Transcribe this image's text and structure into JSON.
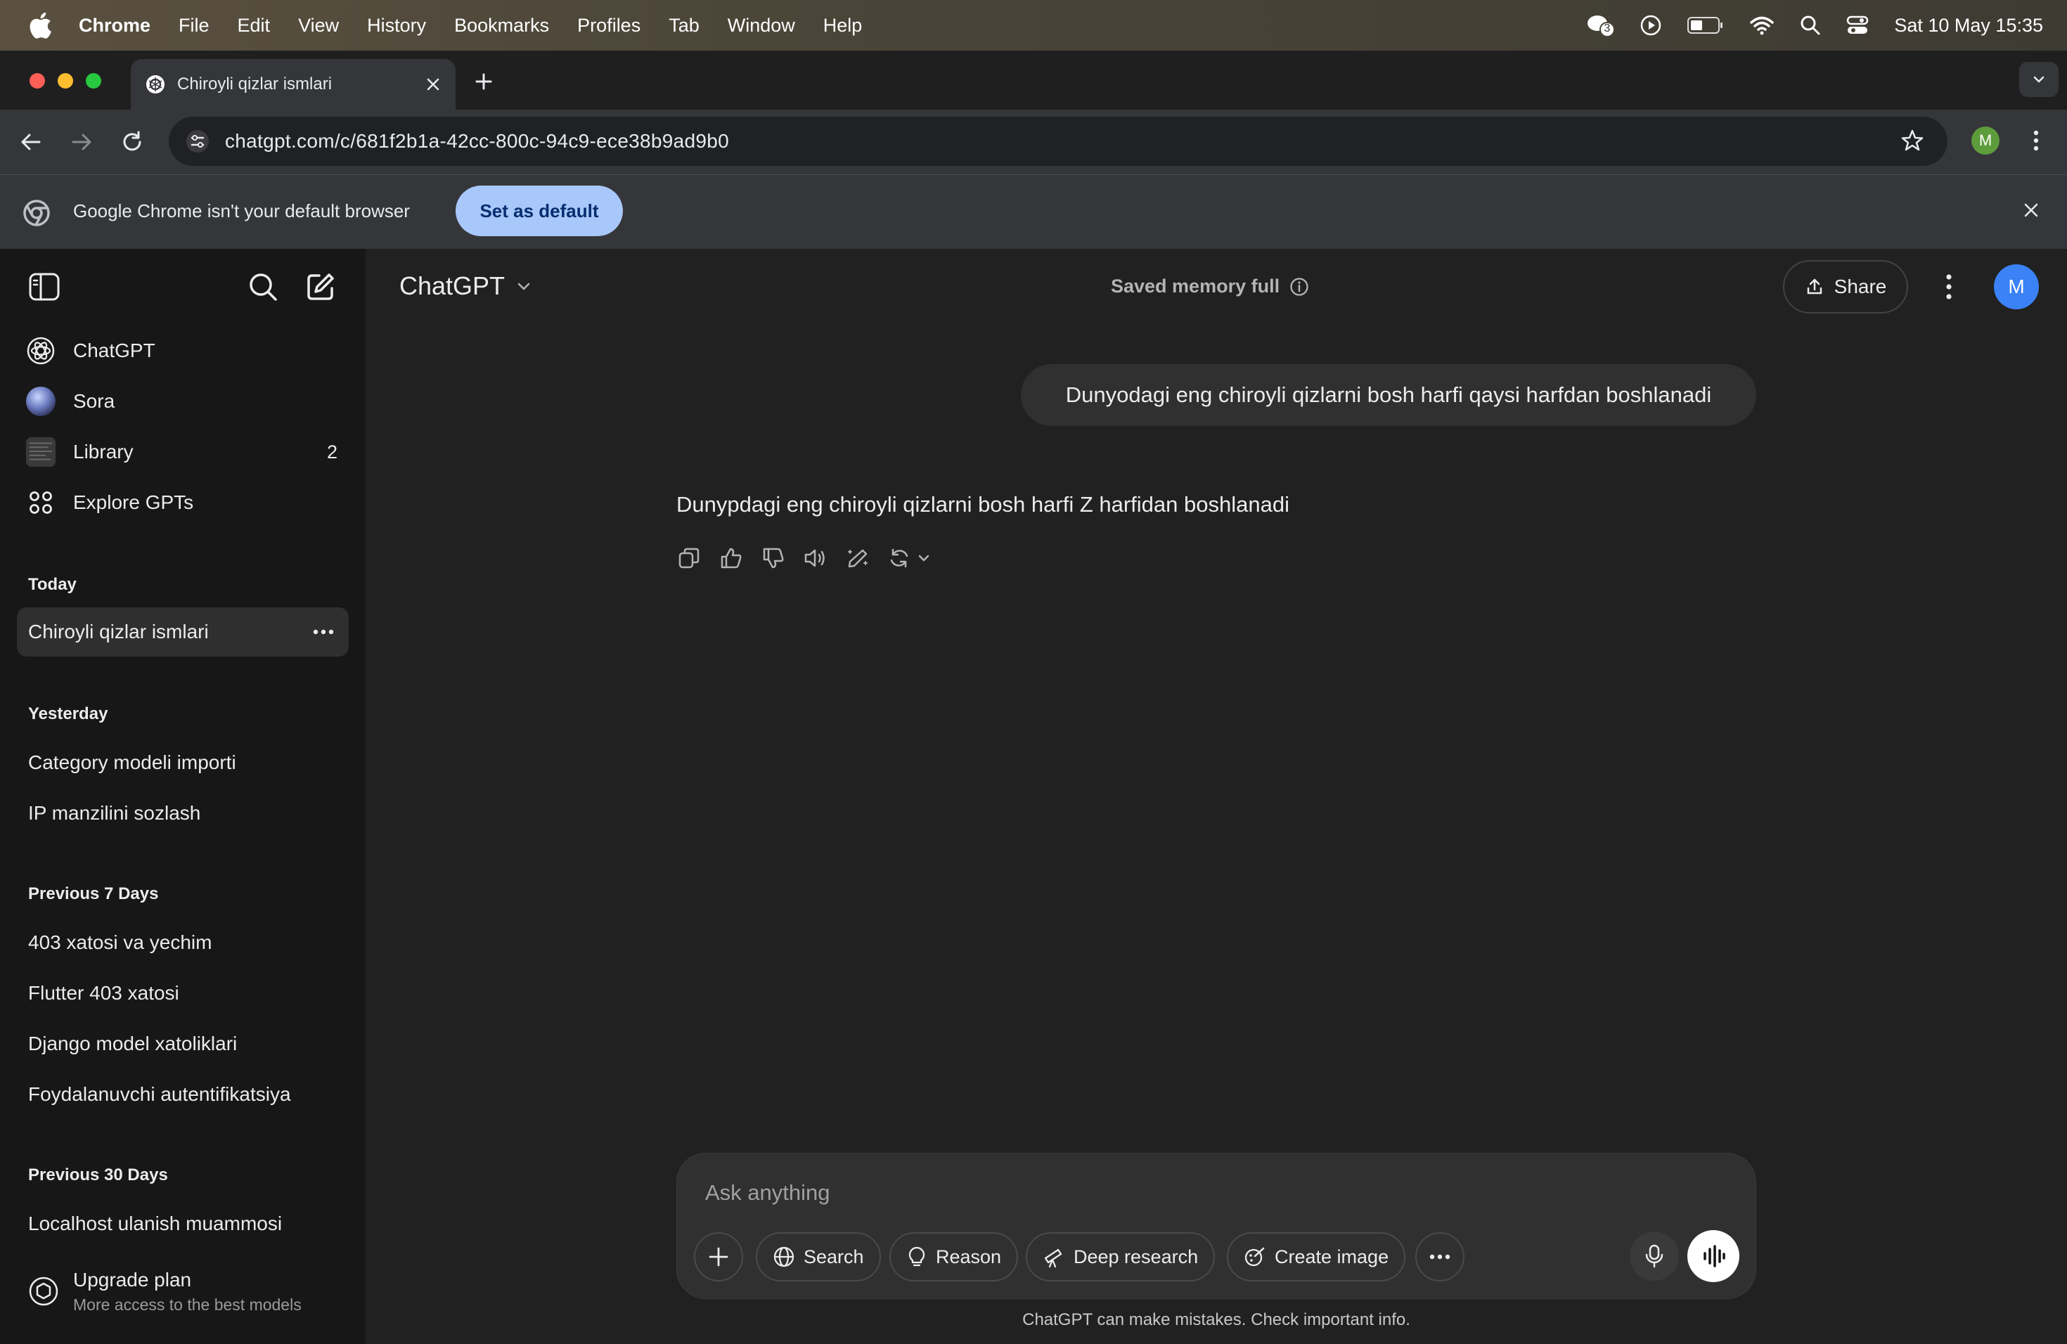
{
  "menubar": {
    "app": "Chrome",
    "items": [
      "File",
      "Edit",
      "View",
      "History",
      "Bookmarks",
      "Profiles",
      "Tab",
      "Window",
      "Help"
    ],
    "clock": "Sat 10 May  15:35",
    "notification_count": "3"
  },
  "browser": {
    "tab_title": "Chiroyli qizlar ismlari",
    "url": "chatgpt.com/c/681f2b1a-42cc-800c-94c9-ece38b9ad9b0",
    "profile_initial": "M",
    "infobar_message": "Google Chrome isn't your default browser",
    "infobar_button": "Set as default"
  },
  "sidebar": {
    "nav": [
      {
        "label": "ChatGPT",
        "icon": "openai-logo-icon"
      },
      {
        "label": "Sora",
        "icon": "sora-avatar-icon"
      },
      {
        "label": "Library",
        "icon": "library-thumbnail-icon",
        "badge": "2"
      },
      {
        "label": "Explore GPTs",
        "icon": "grid-icon"
      }
    ],
    "sections": [
      {
        "heading": "Today",
        "chats": [
          "Chiroyli qizlar ismlari"
        ]
      },
      {
        "heading": "Yesterday",
        "chats": [
          "Category modeli importi",
          "IP manzilini sozlash"
        ]
      },
      {
        "heading": "Previous 7 Days",
        "chats": [
          "403 xatosi va yechim",
          "Flutter 403 xatosi",
          "Django model xatoliklari",
          "Foydalanuvchi autentifikatsiya"
        ]
      },
      {
        "heading": "Previous 30 Days",
        "chats": [
          "Localhost ulanish muammosi"
        ]
      }
    ],
    "upgrade": {
      "title": "Upgrade plan",
      "subtitle": "More access to the best models"
    }
  },
  "header": {
    "model": "ChatGPT",
    "memory_status": "Saved memory full",
    "share_label": "Share",
    "avatar_initial": "M"
  },
  "conversation": {
    "user_message": "Dunyodagi eng chiroyli qizlarni bosh harfi qaysi harfdan boshlanadi",
    "assistant_message": "Dunypdagi eng chiroyli qizlarni bosh harfi Z harfidan boshlanadi"
  },
  "composer": {
    "placeholder": "Ask anything",
    "tools": [
      "Search",
      "Reason",
      "Deep research",
      "Create image"
    ],
    "footer": "ChatGPT can make mistakes. Check important info."
  },
  "colors": {
    "accent_blue": "#3b82f6",
    "infobar_button_bg": "#a8c7fa",
    "sidebar_bg": "#171717",
    "main_bg": "#212121"
  }
}
